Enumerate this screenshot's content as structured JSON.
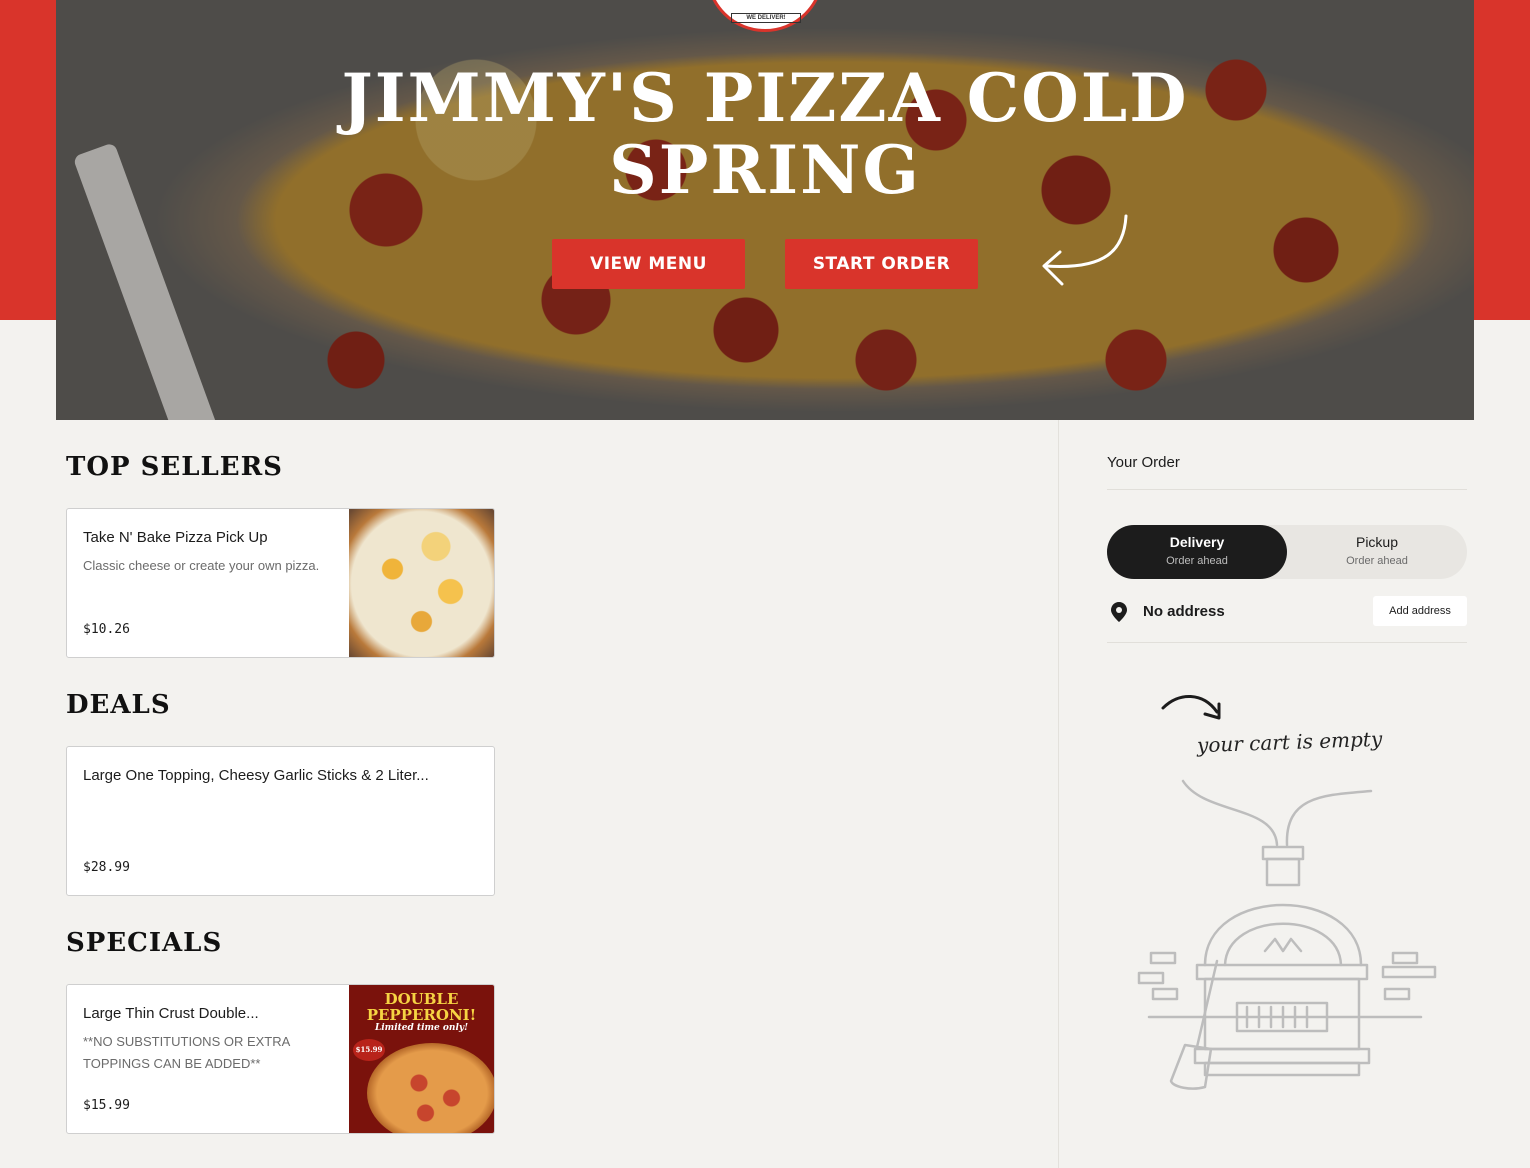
{
  "hero": {
    "title": "JIMMY'S PIZZA COLD SPRING",
    "logo_tagline": "WE DELIVER!",
    "view_menu_label": "VIEW MENU",
    "start_order_label": "START ORDER"
  },
  "sections": [
    {
      "title": "TOP SELLERS",
      "items": [
        {
          "name": "Take N' Bake Pizza Pick Up",
          "description": "Classic cheese or create your own pizza.",
          "price": "$10.26"
        }
      ]
    },
    {
      "title": "DEALS",
      "items": [
        {
          "name": "Large One Topping, Cheesy Garlic Sticks & 2 Liter...",
          "description": "",
          "price": "$28.99"
        }
      ]
    },
    {
      "title": "SPECIALS",
      "items": [
        {
          "name": "Large Thin Crust Double...",
          "description": "**NO SUBSTITUTIONS OR EXTRA TOPPINGS CAN BE ADDED**",
          "price": "$15.99",
          "image_text": {
            "headline": "DOUBLE PEPPERONI!",
            "subline": "Limited time only!",
            "tag": "$15.99"
          }
        }
      ]
    }
  ],
  "order": {
    "title": "Your Order",
    "delivery_label": "Delivery",
    "delivery_sub": "Order ahead",
    "pickup_label": "Pickup",
    "pickup_sub": "Order ahead",
    "address_text": "No address",
    "add_address_label": "Add address",
    "empty_text": "your cart is empty"
  },
  "colors": {
    "brand_red": "#d9342b",
    "dark": "#1c1c1c",
    "sidebar_bg": "#f3f2ef"
  },
  "icons": {
    "address": "map-pin-icon",
    "hero_arrow": "curved-arrow-icon",
    "cart_arrow": "curved-arrow-icon",
    "oven": "pizza-oven-illustration"
  }
}
